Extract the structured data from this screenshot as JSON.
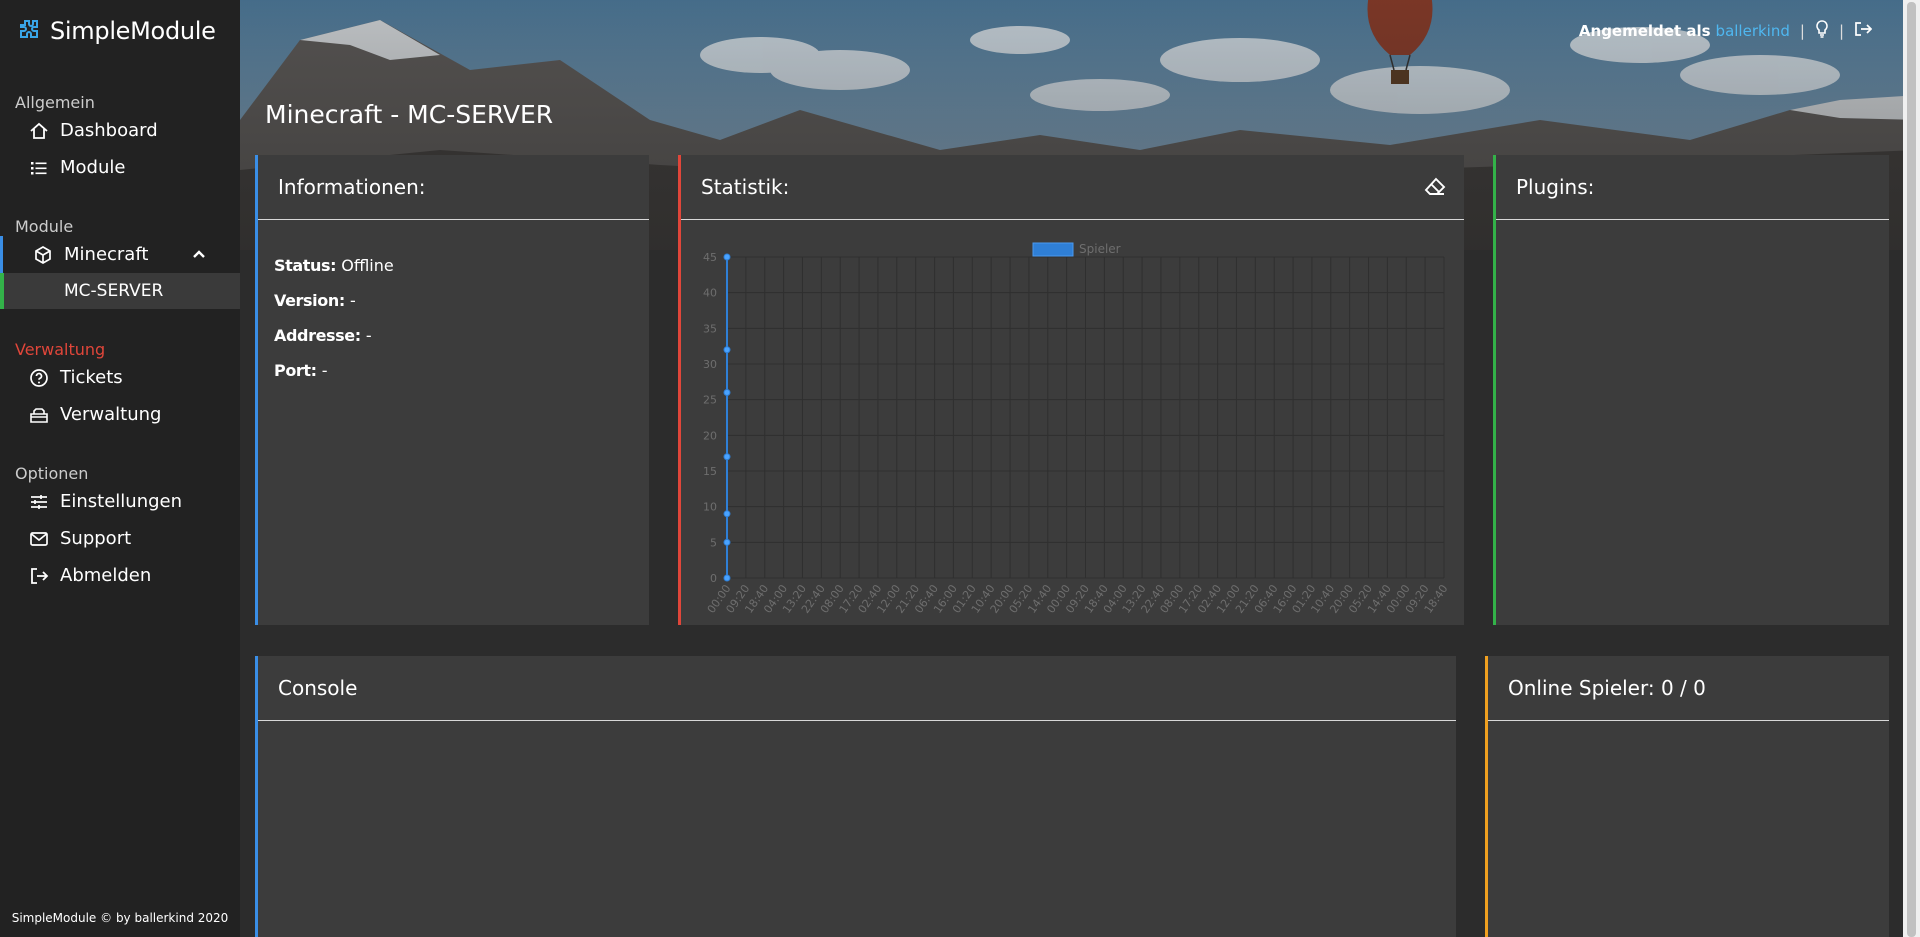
{
  "brand": {
    "name": "SimpleModule"
  },
  "sidebar": {
    "sections": [
      {
        "label": "Allgemein"
      },
      {
        "label": "Module"
      },
      {
        "label": "Verwaltung"
      },
      {
        "label": "Optionen"
      }
    ],
    "items": {
      "dashboard": "Dashboard",
      "module": "Module",
      "minecraft": "Minecraft",
      "mc_server": "MC-SERVER",
      "tickets": "Tickets",
      "verwaltung": "Verwaltung",
      "einstellungen": "Einstellungen",
      "support": "Support",
      "abmelden": "Abmelden"
    },
    "footer": "SimpleModule © by ballerkind 2020"
  },
  "topbar": {
    "prefix": "Angemeldet als",
    "username": "ballerkind"
  },
  "page": {
    "title": "Minecraft - MC-SERVER"
  },
  "info_card": {
    "title": "Informationen:",
    "rows": [
      {
        "label": "Status:",
        "value": "Offline"
      },
      {
        "label": "Version:",
        "value": "-"
      },
      {
        "label": "Addresse:",
        "value": "-"
      },
      {
        "label": "Port:",
        "value": "-"
      }
    ]
  },
  "stats_card": {
    "title": "Statistik:"
  },
  "plugins_card": {
    "title": "Plugins:"
  },
  "console_card": {
    "title": "Console"
  },
  "players_card": {
    "title": "Online Spieler: 0 / 0"
  },
  "colors": {
    "accent_blue": "#3a8ee6",
    "red": "#e0463a",
    "green": "#33b249",
    "orange": "#f0a020",
    "link": "#4fb7f0"
  },
  "chart_data": {
    "type": "line",
    "legend": [
      "Spieler"
    ],
    "x": [
      "00:00",
      "09:20",
      "18:40",
      "04:00",
      "13:20",
      "22:40",
      "08:00",
      "17:20",
      "02:40",
      "12:00",
      "21:20",
      "06:40",
      "16:00",
      "01:20",
      "10:40",
      "20:00",
      "05:20",
      "14:40",
      "00:00",
      "09:20",
      "18:40",
      "04:00",
      "13:20",
      "22:40",
      "08:00",
      "17:20",
      "02:40",
      "12:00",
      "21:20",
      "06:40",
      "16:00",
      "01:20",
      "10:40",
      "20:00",
      "05:20",
      "14:40",
      "00:00",
      "09:20",
      "18:40"
    ],
    "series": [
      {
        "name": "Spieler",
        "points_at_first_x": [
          0,
          5,
          9,
          17,
          26,
          32,
          45
        ]
      }
    ],
    "yticks": [
      0,
      5,
      10,
      15,
      20,
      25,
      30,
      35,
      40,
      45
    ],
    "ylim": [
      0,
      45
    ],
    "grid": true,
    "legend_position": "top-center"
  }
}
